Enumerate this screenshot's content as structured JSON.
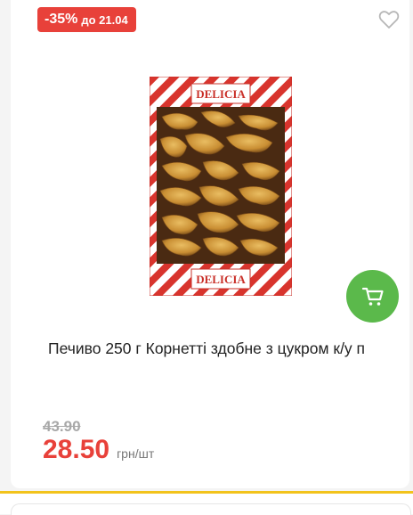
{
  "badge": {
    "discount": "-35%",
    "until": "до 21.04"
  },
  "product": {
    "title": "Печиво 250 г Корнетті здобне з цукром к/у п",
    "brand_on_pack": "DELICIA",
    "old_price": "43.90",
    "new_price": "28.50",
    "unit": "грн/шт"
  },
  "icons": {
    "favorite": "heart-outline-icon",
    "cart": "shopping-cart-icon"
  },
  "colors": {
    "accent_red": "#e8413a",
    "cart_green": "#5bb94b",
    "footer_yellow": "#f2c31c"
  }
}
